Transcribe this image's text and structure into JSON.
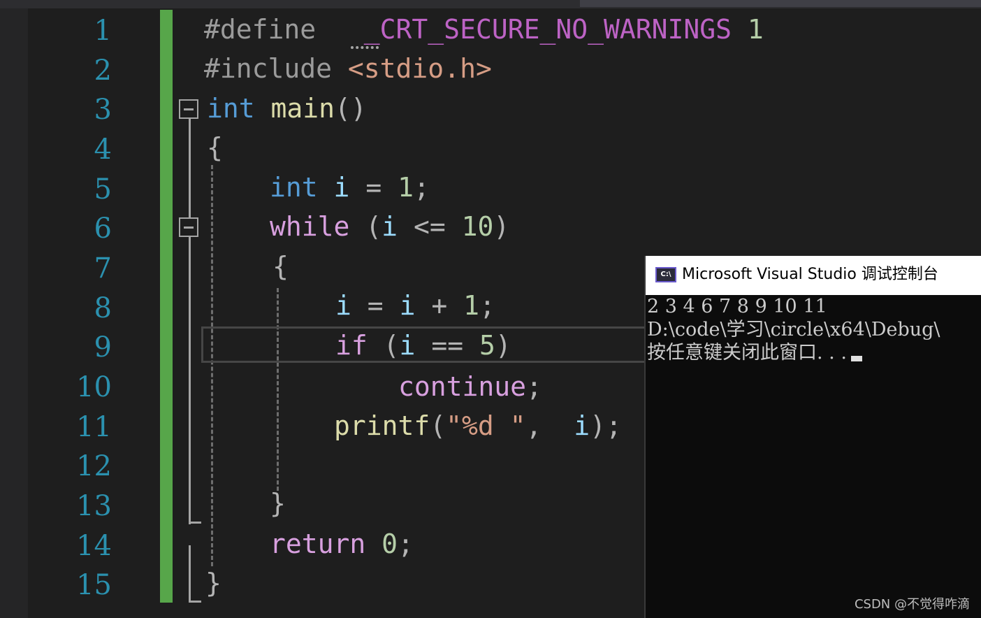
{
  "editor": {
    "line_numbers": [
      "1",
      "2",
      "3",
      "4",
      "5",
      "6",
      "7",
      "8",
      "9",
      "10",
      "11",
      "12",
      "13",
      "14",
      "15"
    ],
    "code": {
      "l1_directive": "#define",
      "l1_macro": "_CRT_SECURE_NO_WARNINGS",
      "l1_value": "1",
      "l2_directive": "#include",
      "l2_header": "<stdio.h>",
      "l3_type": "int",
      "l3_func": "main",
      "l3_parens": "()",
      "l4_brace": "{",
      "l5_type": "int",
      "l5_var": "i",
      "l5_op": "=",
      "l5_num": "1",
      "l5_semi": ";",
      "l6_kw": "while",
      "l6_open": "(",
      "l6_var": "i",
      "l6_op": "<=",
      "l6_num": "10",
      "l6_close": ")",
      "l7_brace": "{",
      "l8_var1": "i",
      "l8_op1": "=",
      "l8_var2": "i",
      "l8_op2": "+",
      "l8_num": "1",
      "l8_semi": ";",
      "l9_kw": "if",
      "l9_open": "(",
      "l9_var": "i",
      "l9_op": "==",
      "l9_num": "5",
      "l9_close": ")",
      "l10_kw": "continue",
      "l10_semi": ";",
      "l11_func": "printf",
      "l11_open": "(",
      "l11_str": "\"%d \"",
      "l11_comma": ",",
      "l11_var": "i",
      "l11_close": ");",
      "l13_brace": "}",
      "l14_kw": "return",
      "l14_num": "0",
      "l14_semi": ";",
      "l15_brace": "}"
    }
  },
  "console": {
    "title": "Microsoft Visual Studio 调试控制台",
    "icon": "console-app-icon",
    "icon_text": "C:\\",
    "output_lines": [
      "2 3 4 6 7 8 9 10 11",
      "D:\\code\\学习\\circle\\x64\\Debug\\",
      "按任意键关闭此窗口. . ."
    ]
  },
  "watermark": "CSDN @不觉得咋滴",
  "colors": {
    "background": "#1e1e1e",
    "line_number": "#2b91af",
    "keyword": "#569cd6",
    "control_keyword": "#d8a0df",
    "change_bar": "#57a64a"
  }
}
